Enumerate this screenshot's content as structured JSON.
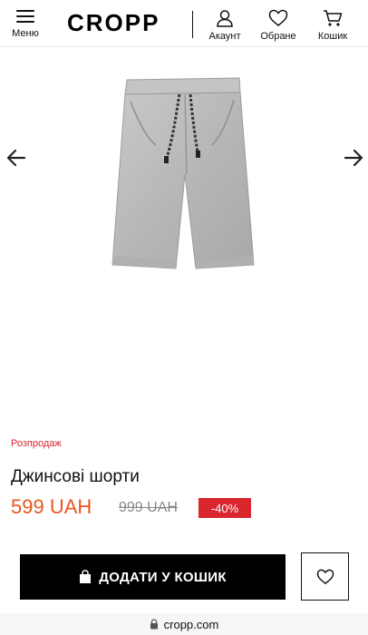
{
  "header": {
    "menu_label": "Меню",
    "logo": "CROPP",
    "account_label": "Акаунт",
    "favorites_label": "Обране",
    "cart_label": "Кошик"
  },
  "product": {
    "badge": "Розпродаж",
    "title": "Джинсові шорти",
    "price": "599 UAH",
    "old_price": "999 UAH",
    "discount": "-40%"
  },
  "actions": {
    "add_to_cart_label": "ДОДАТИ У КОШИК"
  },
  "browser": {
    "url": "cropp.com"
  },
  "colors": {
    "price": "#e8561f",
    "sale": "#d9262e",
    "button": "#000000"
  },
  "icons": [
    "menu-icon",
    "user-icon",
    "heart-icon",
    "cart-icon",
    "arrow-left-icon",
    "arrow-right-icon",
    "bag-icon",
    "lock-icon"
  ]
}
